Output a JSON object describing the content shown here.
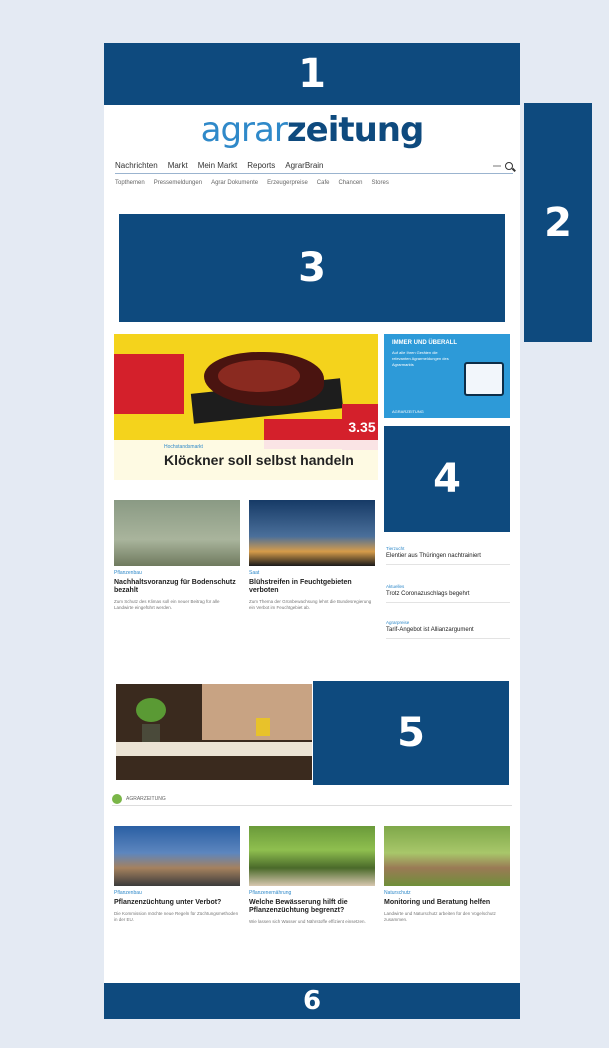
{
  "slots": [
    "1",
    "2",
    "3",
    "4",
    "5",
    "6"
  ],
  "logo": {
    "part1": "agrar",
    "part2": "zeitung"
  },
  "nav": {
    "items": [
      "Nachrichten",
      "Markt",
      "Mein Markt",
      "Reports",
      "AgrarBrain"
    ]
  },
  "subnav": {
    "items": [
      "Topthemen",
      "Pressemeldungen",
      "Agrar Dokumente",
      "Erzeugerpreise",
      "Cafe",
      "Chancen",
      "Stores"
    ]
  },
  "hero": {
    "tag": "Hochstandsmarkt",
    "title": "Klöckner soll selbst handeln",
    "price": "3.35"
  },
  "ad": {
    "title": "IMMER UND ÜBERALL",
    "text": "Auf alle Ihren Geräten die relevanten Agrarmeldungen des Agrarmarkts",
    "foot": "AGRARZEITUNG"
  },
  "cards": [
    {
      "tag": "Pflanzenbau",
      "title": "Nachhaltsvoranzug für Bodenschutz bezahlt",
      "text": "Zum Schutz des Klimas soll ein neuer Beitrag für alle Landwirte eingeführt werden."
    },
    {
      "tag": "Saat",
      "title": "Blühstreifen in Feuchtgebieten verboten",
      "text": "Zum Thema der Grünbewachsung lehnt die Bundesregierung ein Verbot im Feuchtgebiet ab."
    }
  ],
  "side": [
    {
      "tag": "Tierzucht",
      "title": "Elentier aus Thüringen nachtrainiert"
    },
    {
      "tag": "Aktuelles",
      "title": "Trotz Coronazuschlags begehrt"
    },
    {
      "tag": "Agrarpreise",
      "title": "Tarif-Angebot ist Allianzargument"
    }
  ],
  "section": {
    "label": "AGRARZEITUNG"
  },
  "bottom_cards": [
    {
      "tag": "Pflanzenbau",
      "title": "Pflanzenzüchtung unter Verbot?",
      "text": "Die Kommission möchte neue Regeln für Züchtungsmethoden in der EU."
    },
    {
      "tag": "Pflanzenernährung",
      "title": "Welche Bewässerung hilft die Pflanzenzüchtung begrenzt?",
      "text": "Wie lassen sich Wasser und Nährstoffe effizient einsetzen."
    },
    {
      "tag": "Naturschutz",
      "title": "Monitoring und Beratung helfen",
      "text": "Landwirte und Naturschutz arbeiten für den Vogelschutz zusammen."
    }
  ],
  "colors": {
    "primary": "#0e4a7e",
    "accent": "#2f89c9"
  }
}
